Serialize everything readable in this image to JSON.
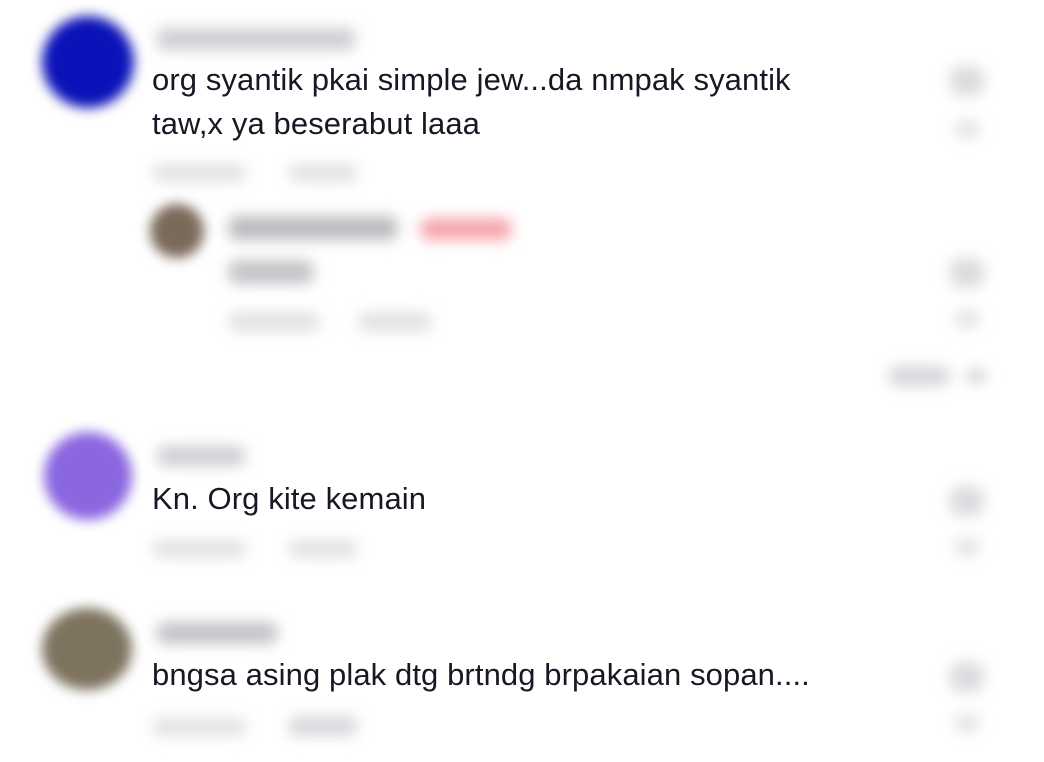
{
  "comments": [
    {
      "avatar_color": "#0b12b8",
      "text_line_1": "org syantik pkai simple jew...da nmpak syantik",
      "text_line_2": "taw,x ya beserabut laaa"
    },
    {
      "avatar_color": "#8a66e0",
      "text_line_1": "Kn. Org kite kemain"
    },
    {
      "avatar_color": "#7d735f",
      "text_line_1": "bngsa asing plak dtg brtndg brpakaian sopan...."
    }
  ],
  "reply": {
    "avatar_color": "#7a6a5a",
    "badge_color": "#f7a4ad"
  },
  "icons": {
    "like": "heart-icon",
    "dislike": "thumbs-down-icon",
    "collapse": "chevron-up-icon"
  }
}
